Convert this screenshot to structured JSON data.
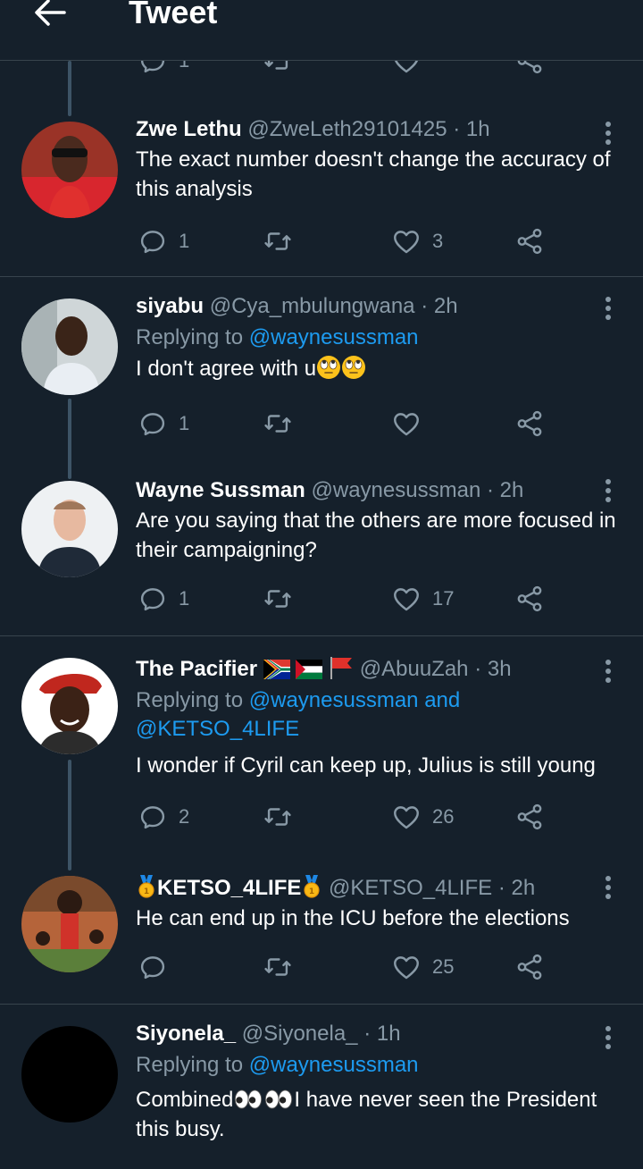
{
  "header": {
    "title": "Tweet"
  },
  "partial_actions": {
    "reply_count": "1"
  },
  "tweets": [
    {
      "name": "Zwe Lethu",
      "handle": "@ZweLeth29101425",
      "time": "· 1h",
      "text": "The exact number doesn't change the accuracy of this analysis",
      "replies": "1",
      "retweets": "",
      "likes": "3"
    },
    {
      "name": "siyabu",
      "handle": "@Cya_mbulungwana",
      "time": "· 2h",
      "replying_prefix": "Replying to ",
      "replying_to": "@waynesussman",
      "text": "I don't agree with u",
      "replies": "1",
      "retweets": "",
      "likes": ""
    },
    {
      "name": "Wayne Sussman",
      "handle": "@waynesussman",
      "time": "· 2h",
      "text": "Are you saying that the others are more focused in their campaigning?",
      "replies": "1",
      "retweets": "",
      "likes": "17"
    },
    {
      "name": "The Pacifier",
      "handle": "@AbuuZah",
      "time": "· 3h",
      "replying_prefix": "Replying to ",
      "replying_to": "@waynesussman and @KETSO_4LIFE",
      "text": "I wonder if Cyril can keep up, Julius is still young",
      "replies": "2",
      "retweets": "",
      "likes": "26"
    },
    {
      "name": "KETSO_4LIFE",
      "handle": "@KETSO_4LIFE",
      "time": "· 2h",
      "text": "He can end up in the ICU before the elections",
      "replies": "",
      "retweets": "",
      "likes": "25"
    },
    {
      "name": "Siyonela_",
      "handle": "@Siyonela_",
      "time": "· 1h",
      "replying_prefix": "Replying to ",
      "replying_to": "@waynesussman",
      "text_a": "Combined",
      "text_b": "I have never seen the President this busy."
    }
  ],
  "colors": {
    "bg": "#15202b",
    "secondary": "#8899a6",
    "link": "#1d9bf0",
    "divider": "#38444d"
  },
  "icons": [
    "back-arrow-icon",
    "reply-icon",
    "retweet-icon",
    "heart-icon",
    "share-icon",
    "more-icon",
    "rolling-eyes-emoji",
    "eyes-emoji",
    "medal-emoji",
    "flag-emoji"
  ]
}
